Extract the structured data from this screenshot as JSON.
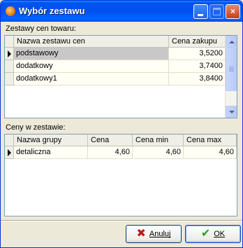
{
  "window": {
    "title": "Wybór zestawu",
    "controls": {
      "min": "_",
      "max": "□",
      "close": "×"
    }
  },
  "sets": {
    "label": "Zestawy cen towaru:",
    "columns": [
      "Nazwa zestawu cen",
      "Cena zakupu"
    ],
    "rows": [
      {
        "name": "podstawowy",
        "price": "3,5200"
      },
      {
        "name": "dodatkowy",
        "price": "3,7400"
      },
      {
        "name": "dodatkowy1",
        "price": "3,8400"
      }
    ],
    "selected_index": 0
  },
  "prices": {
    "label": "Ceny w zestawie:",
    "columns": [
      "Nazwa grupy",
      "Cena",
      "Cena min",
      "Cena max"
    ],
    "rows": [
      {
        "group": "detaliczna",
        "price": "4,60",
        "min": "4,60",
        "max": "4,60"
      }
    ]
  },
  "buttons": {
    "cancel": "Anuluj",
    "ok": "OK"
  },
  "icons": {
    "cancel": "x-icon",
    "ok": "checkmark-icon"
  },
  "colors": {
    "title_bar": "#0054e3",
    "selection_outline": "#d32a2a",
    "grid_background": "#fffff5"
  }
}
